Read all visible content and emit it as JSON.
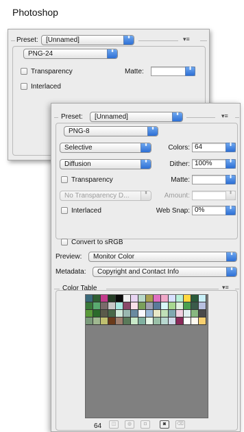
{
  "app_title": "Photoshop",
  "back_panel": {
    "preset_label": "Preset:",
    "preset_value": "[Unnamed]",
    "format_value": "PNG-24",
    "transparency_label": "Transparency",
    "matte_label": "Matte:",
    "interlaced_label": "Interlaced"
  },
  "front_panel": {
    "preset_label": "Preset:",
    "preset_value": "[Unnamed]",
    "format_value": "PNG-8",
    "reduction_value": "Selective",
    "colors_label": "Colors:",
    "colors_value": "64",
    "dither_algo_value": "Diffusion",
    "dither_label": "Dither:",
    "dither_value": "100%",
    "transparency_label": "Transparency",
    "matte_label": "Matte:",
    "transparency_dither_value": "No Transparency D...",
    "amount_label": "Amount:",
    "interlaced_label": "Interlaced",
    "websnap_label": "Web Snap:",
    "websnap_value": "0%",
    "convert_srgb_label": "Convert to sRGB",
    "preview_label": "Preview:",
    "preview_value": "Monitor Color",
    "metadata_label": "Metadata:",
    "metadata_value": "Copyright and Contact Info",
    "color_table_label": "Color Table",
    "color_count": "64"
  },
  "icons": {
    "arrow": "⬍",
    "menu": "▾≡"
  },
  "color_table": {
    "rows": [
      [
        "#3a6a7a",
        "#2f5f33",
        "#c23c8c",
        "#243c25",
        "#0a0a0a",
        "#f0f0f0",
        "#e8d4f2",
        "#b8d8c8",
        "#a8a050",
        "#e070c0",
        "#f0a8c8",
        "#d8e0ff",
        "#b8f0d8",
        "#ffd840",
        "#2a5a3a",
        "#c8f0f8"
      ],
      [
        "#3a7a3a",
        "#5aaa70",
        "#7a6a6a",
        "#c8c8c8",
        "#a8e8e0",
        "#8a4a6a",
        "#f8e0e8",
        "#7aa05a",
        "#a0a0b0",
        "#5a7a9a",
        "#d8f8f8",
        "#a8d890",
        "#e0f0e0",
        "#4aa050",
        "#3a5a4a",
        "#b8c0e0"
      ],
      [
        "#5a9a3a",
        "#2a6a2a",
        "#5a5a4a",
        "#486848",
        "#d0e8d8",
        "#9ab8b0",
        "#6a8aa0",
        "#f8f8ff",
        "#98b8d8",
        "#e8e8c8",
        "#c0e0b8",
        "#80a8b0",
        "#f0d0e0",
        "#e0f0f0",
        "#88b880",
        "#4a4a4a"
      ],
      [
        "#7a9a7a",
        "#a0b890",
        "#c0c070",
        "#6a3a1a",
        "#a08070",
        "#5a7a5a",
        "#c8e8c8",
        "#80b0a0",
        "#e8f8e8",
        "#9ac0a8",
        "#b8d8d0",
        "#d0d8e8",
        "#8a2a5a",
        "#ffffff",
        "#fffaf0",
        "#f8d070"
      ]
    ]
  }
}
